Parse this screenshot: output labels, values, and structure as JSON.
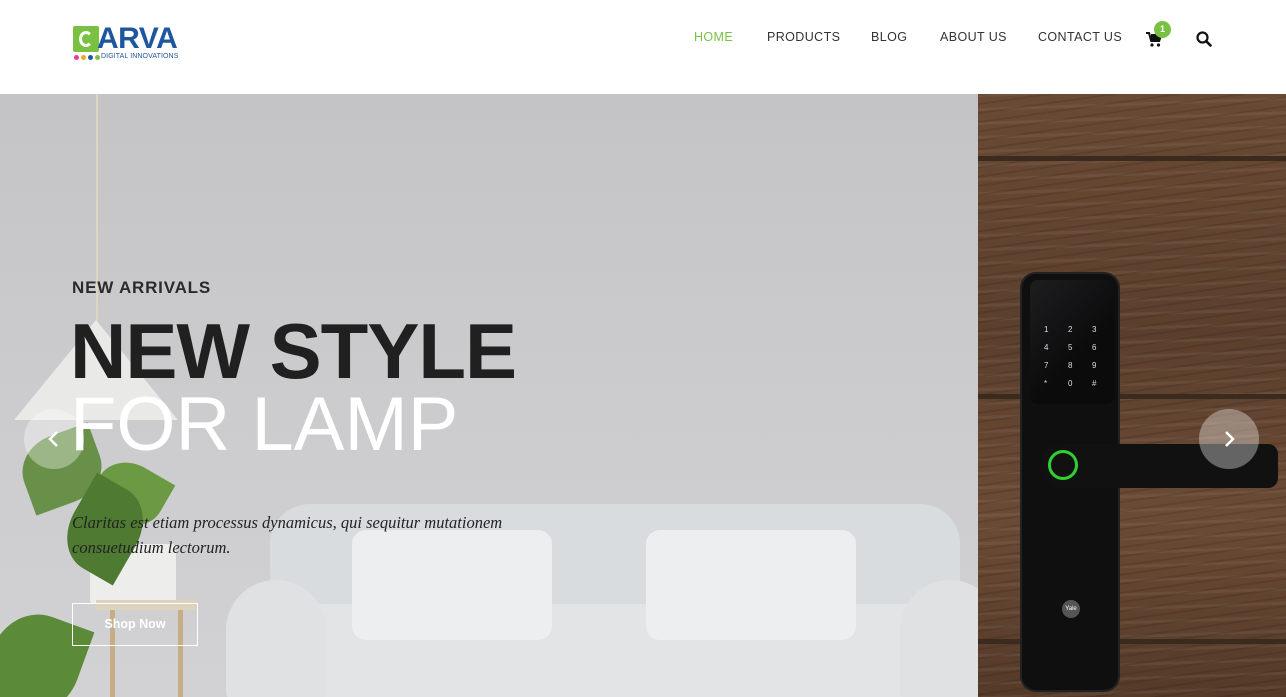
{
  "brand": {
    "name": "ARVA",
    "tagline": "DIGITAL INNOVATIONS",
    "colors": {
      "primary": "#1e56a0",
      "accent": "#7ac143"
    }
  },
  "nav": {
    "items": [
      {
        "label": "HOME",
        "active": true
      },
      {
        "label": "PRODUCTS",
        "active": false
      },
      {
        "label": "BLOG",
        "active": false
      },
      {
        "label": "ABOUT US",
        "active": false
      },
      {
        "label": "CONTACT US",
        "active": false
      }
    ],
    "cart": {
      "icon": "cart-icon",
      "count": "1"
    },
    "search": {
      "icon": "search-icon"
    }
  },
  "hero": {
    "eyebrow": "NEW ARRIVALS",
    "headline_line1": "NEW STYLE",
    "headline_line2": "FOR LAMP",
    "description": "Claritas est etiam processus dynamicus, qui sequitur mutationem consuetudium lectorum.",
    "cta_label": "Shop Now",
    "prev_icon": "chevron-left-icon",
    "next_icon": "chevron-right-icon",
    "lock_keys": [
      "1",
      "2",
      "3",
      "4",
      "5",
      "6",
      "7",
      "8",
      "9",
      "*",
      "0",
      "#"
    ],
    "lock_brand": "Yale"
  }
}
